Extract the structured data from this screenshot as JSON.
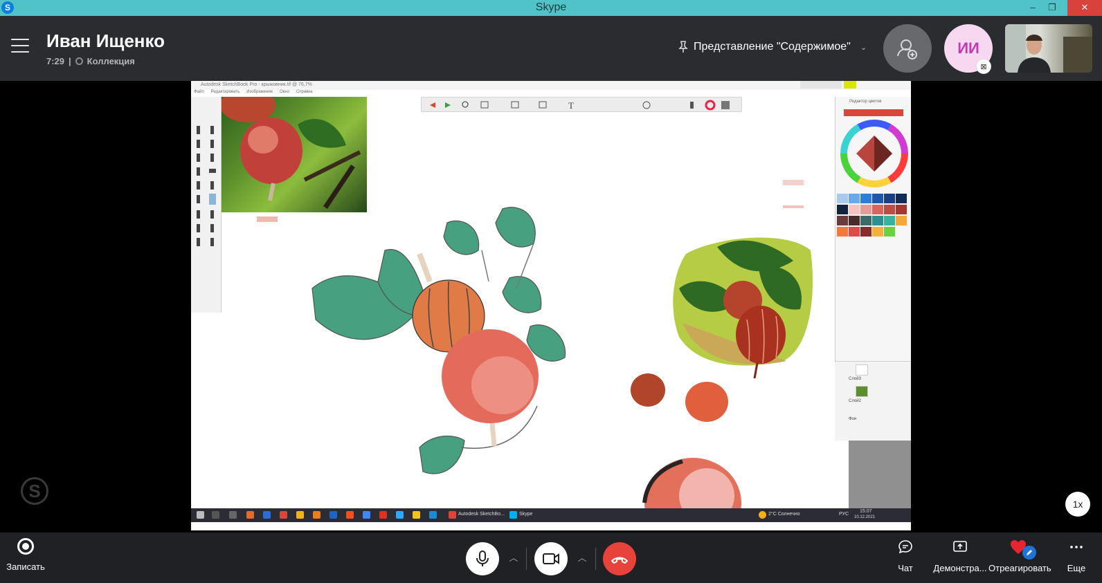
{
  "window": {
    "title": "Skype",
    "controls": {
      "minimize": "–",
      "restore": "❐",
      "close": "✕"
    }
  },
  "header": {
    "caller_name": "Иван Ищенко",
    "call_duration": "7:29",
    "separator": "|",
    "collection_label": "Коллекция",
    "view_mode_label": "Представление \"Содержимое\"",
    "avatar_initials": "ИИ",
    "icons": [
      "menu-icon",
      "pin-icon",
      "add-participant-icon",
      "screen-share-badge-icon"
    ]
  },
  "shared_screen": {
    "window_title": "Autodesk SketchBook Pro - крыжовник.tif @ 76,7%",
    "menu": [
      "Файл",
      "Редактировать",
      "Изображение",
      "Окно",
      "Справка"
    ],
    "color_panel_title": "Редактор цветов",
    "layers": [
      {
        "name": "Слой3"
      },
      {
        "name": "Слой2"
      },
      {
        "name": "Фон"
      }
    ],
    "taskbar": {
      "apps": [
        {
          "label": "Autodesk SketchBo..."
        },
        {
          "label": "Skype"
        }
      ],
      "weather": "2°C Солнечно",
      "language": "РУС",
      "time": "15:07",
      "date": "10.12.2021"
    },
    "accent_colors": {
      "toolbar_active": "#d8e600",
      "brush_swatch": "#d9463a"
    }
  },
  "zoom_label": "1x",
  "controls": {
    "record_label": "Записать",
    "chat_label": "Чат",
    "share_label": "Демонстра...",
    "react_label": "Отреагировать",
    "more_label": "Еще"
  },
  "colors": {
    "title_bar": "#4fc3c8",
    "header_bg": "#2b2c2f",
    "controls_bg": "#202124",
    "hangup": "#e8433a",
    "avatar_bg": "#f6d8f0",
    "avatar_text": "#c03bb4"
  }
}
